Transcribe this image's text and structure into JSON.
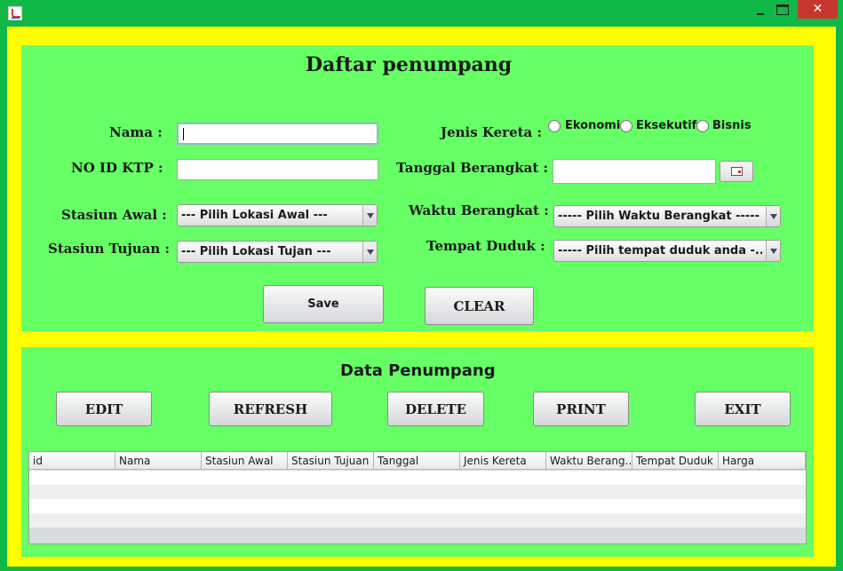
{
  "window": {
    "close_glyph": "✕"
  },
  "form": {
    "title": "Daftar penumpang",
    "nama_label": "Nama :",
    "nama_value": "",
    "ktp_label": "NO ID KTP :",
    "ktp_value": "",
    "stasiun_awal_label": "Stasiun Awal :",
    "stasiun_awal_selected": "--- Pilih Lokasi Awal ---",
    "stasiun_tujuan_label": "Stasiun Tujuan :",
    "stasiun_tujuan_selected": "--- Pilih Lokasi Tujan ---",
    "jenis_kereta_label": "Jenis Kereta :",
    "jenis_kereta_options": [
      "Ekonomi",
      "Eksekutif",
      "Bisnis"
    ],
    "tanggal_label": "Tanggal Berangkat :",
    "tanggal_value": "",
    "waktu_label": "Waktu Berangkat :",
    "waktu_selected": "----- Pilih Waktu Berangkat -----",
    "tempat_duduk_label": "Tempat Duduk :",
    "tempat_duduk_selected": "----- Pilih tempat duduk anda -...",
    "save_label": "Save",
    "clear_label": "CLEAR"
  },
  "data_section": {
    "title": "Data Penumpang",
    "buttons": [
      "EDIT",
      "REFRESH",
      "DELETE",
      "PRINT",
      "EXIT"
    ]
  },
  "table": {
    "columns": [
      "id",
      "Nama",
      "Stasiun Awal",
      "Stasiun Tujuan",
      "Tanggal",
      "Jenis Kereta",
      "Waktu Berang...",
      "Tempat Duduk",
      "Harga"
    ],
    "rows": []
  },
  "colors": {
    "titlebar": "#0fb847",
    "frame_border": "#ffff00",
    "panel": "#66ff66",
    "close_button": "#c7372f"
  }
}
